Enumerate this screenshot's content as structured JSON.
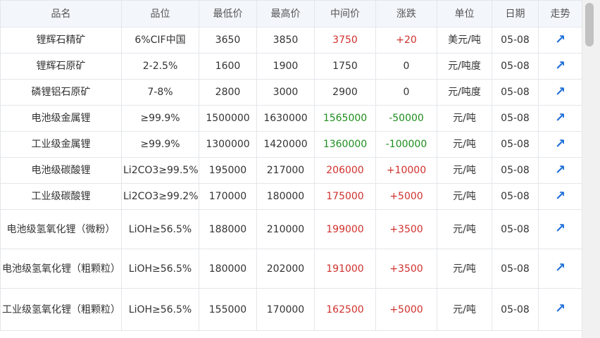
{
  "headers": [
    "品名",
    "品位",
    "最低价",
    "最高价",
    "中间价",
    "涨跌",
    "单位",
    "日期",
    "走势"
  ],
  "trend_icon": "chart-trend-icon",
  "colors": {
    "up": "#d0312d",
    "down": "#1e8e1e",
    "accent": "#1e6fd9"
  },
  "rows": [
    {
      "name": "锂辉石精矿",
      "grade": "6%CIF中国",
      "low": "3650",
      "high": "3850",
      "mid": "3750",
      "change": "+20",
      "unit": "美元/吨",
      "date": "05-08",
      "dir": "up"
    },
    {
      "name": "锂辉石原矿",
      "grade": "2-2.5%",
      "low": "1600",
      "high": "1900",
      "mid": "1750",
      "change": "0",
      "unit": "元/吨度",
      "date": "05-08",
      "dir": "flat"
    },
    {
      "name": "磷锂铝石原矿",
      "grade": "7-8%",
      "low": "2800",
      "high": "3000",
      "mid": "2900",
      "change": "0",
      "unit": "元/吨度",
      "date": "05-08",
      "dir": "flat"
    },
    {
      "name": "电池级金属锂",
      "grade": "≥99.9%",
      "low": "1500000",
      "high": "1630000",
      "mid": "1565000",
      "change": "-50000",
      "unit": "元/吨",
      "date": "05-08",
      "dir": "down"
    },
    {
      "name": "工业级金属锂",
      "grade": "≥99.9%",
      "low": "1300000",
      "high": "1420000",
      "mid": "1360000",
      "change": "-100000",
      "unit": "元/吨",
      "date": "05-08",
      "dir": "down"
    },
    {
      "name": "电池级碳酸锂",
      "grade": "Li2CO3≥99.5%",
      "low": "195000",
      "high": "217000",
      "mid": "206000",
      "change": "+10000",
      "unit": "元/吨",
      "date": "05-08",
      "dir": "up"
    },
    {
      "name": "工业级碳酸锂",
      "grade": "Li2CO3≥99.2%",
      "low": "170000",
      "high": "180000",
      "mid": "175000",
      "change": "+5000",
      "unit": "元/吨",
      "date": "05-08",
      "dir": "up"
    },
    {
      "name": "电池级氢氧化锂（微粉）",
      "grade": "LiOH≥56.5%",
      "low": "188000",
      "high": "210000",
      "mid": "199000",
      "change": "+3500",
      "unit": "元/吨",
      "date": "05-08",
      "dir": "up"
    },
    {
      "name": "电池级氢氧化锂（粗颗粒）",
      "grade": "LiOH≥56.5%",
      "low": "180000",
      "high": "202000",
      "mid": "191000",
      "change": "+3500",
      "unit": "元/吨",
      "date": "05-08",
      "dir": "up"
    },
    {
      "name": "工业级氢氧化锂（粗颗粒）",
      "grade": "LiOH≥56.5%",
      "low": "155000",
      "high": "170000",
      "mid": "162500",
      "change": "+5000",
      "unit": "元/吨",
      "date": "05-08",
      "dir": "up"
    }
  ]
}
